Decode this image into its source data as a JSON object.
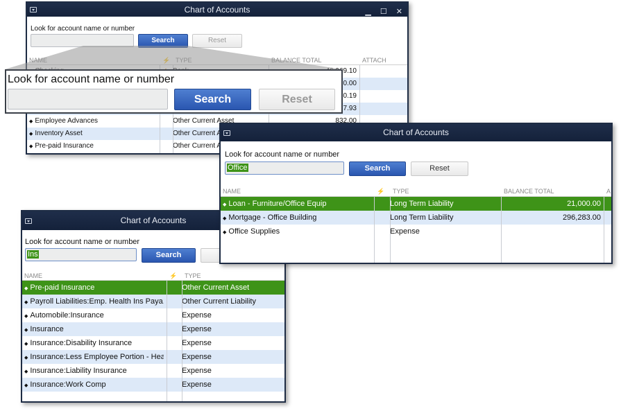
{
  "colors": {
    "title_bar": "#1a2740",
    "selected_row": "#3e9318",
    "alt_row": "#dde9f8",
    "search_button": "#3a67c0"
  },
  "icons": {
    "system_menu": "window-menu-icon",
    "spell": "lightning-icon",
    "bullet": "diamond-bullet-icon"
  },
  "windows": [
    {
      "id": "main",
      "title": "Chart of Accounts",
      "search_label": "Look for account name or number",
      "search_value": "",
      "search_button": "Search",
      "reset_button": "Reset",
      "columns": [
        "NAME",
        "⚡",
        "TYPE",
        "BALANCE TOTAL",
        "ATTACH"
      ],
      "rows": [
        {
          "name": "Checking",
          "flag": "✓",
          "type": "Bank",
          "balance": "46,969.10"
        },
        {
          "name": "",
          "flag": "",
          "type": "",
          "balance": "0.00"
        },
        {
          "name": "",
          "flag": "",
          "type": "",
          "balance": "0.19"
        },
        {
          "name": "",
          "flag": "",
          "type": "",
          "balance": "7.93"
        },
        {
          "name": "Employee Advances",
          "flag": "",
          "type": "Other Current Asset",
          "balance": "832.00"
        },
        {
          "name": "Inventory Asset",
          "flag": "",
          "type": "Other Current Asset",
          "balance": ""
        },
        {
          "name": "Pre-paid Insurance",
          "flag": "",
          "type": "Other Current Asset",
          "balance": ""
        }
      ]
    },
    {
      "id": "ins",
      "title": "Chart of Accounts",
      "search_label": "Look for account name or number",
      "search_value": "Ins",
      "search_button": "Search",
      "reset_button": "Reset",
      "columns": [
        "NAME",
        "⚡",
        "TYPE"
      ],
      "rows": [
        {
          "name": "Pre-paid Insurance",
          "type": "Other Current Asset",
          "selected": true
        },
        {
          "name": "Payroll Liabilities:Emp. Health Ins Paya...",
          "type": "Other Current Liability"
        },
        {
          "name": "Automobile:Insurance",
          "type": "Expense"
        },
        {
          "name": "Insurance",
          "type": "Expense"
        },
        {
          "name": "Insurance:Disability Insurance",
          "type": "Expense"
        },
        {
          "name": "Insurance:Less Employee Portion - Hea...",
          "type": "Expense"
        },
        {
          "name": "Insurance:Liability Insurance",
          "type": "Expense"
        },
        {
          "name": "Insurance:Work Comp",
          "type": "Expense"
        }
      ]
    },
    {
      "id": "office",
      "title": "Chart of Accounts",
      "search_label": "Look for account name or number",
      "search_value": "Office",
      "search_button": "Search",
      "reset_button": "Reset",
      "columns": [
        "NAME",
        "⚡",
        "TYPE",
        "BALANCE TOTAL",
        "A"
      ],
      "rows": [
        {
          "name": "Loan - Furniture/Office Equip",
          "type": "Long Term Liability",
          "balance": "21,000.00",
          "selected": true
        },
        {
          "name": "Mortgage - Office Building",
          "type": "Long Term Liability",
          "balance": "296,283.00"
        },
        {
          "name": "Office Supplies",
          "type": "Expense",
          "balance": ""
        }
      ]
    }
  ],
  "magnifier": {
    "search_label": "Look for account name or number",
    "search_button": "Search",
    "reset_button": "Reset"
  }
}
